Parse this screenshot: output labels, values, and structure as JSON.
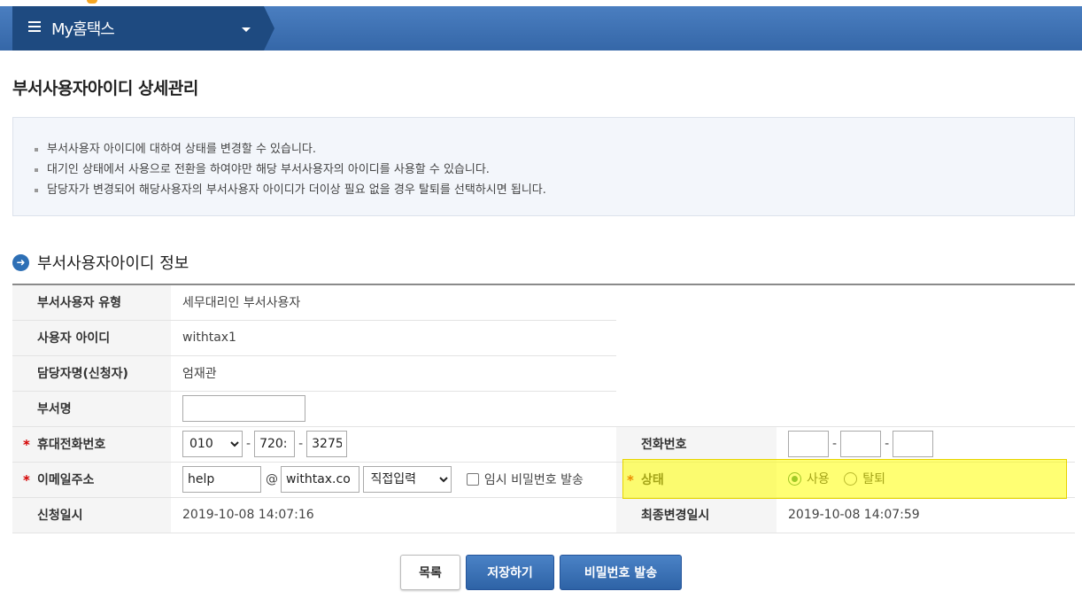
{
  "header": {
    "menu_title": "My홈택스"
  },
  "page": {
    "title": "부서사용자아이디 상세관리"
  },
  "notice": {
    "items": [
      "부서사용자 아이디에 대하여 상태를 변경할 수 있습니다.",
      "대기인 상태에서 사용으로 전환을 하여야만 해당 부서사용자의 아이디를 사용할 수 있습니다.",
      "담당자가 변경되어 해당사용자의 부서사용자 아이디가 더이상 필요 없을 경우 탈퇴를 선택하시면 됩니다."
    ]
  },
  "section": {
    "title": "부서사용자아이디 정보"
  },
  "form": {
    "user_type_label": "부서사용자 유형",
    "user_type_value": "세무대리인 부서사용자",
    "user_id_label": "사용자 아이디",
    "user_id_value": "withtax1",
    "manager_label": "담당자명(신청자)",
    "manager_value": "엄재관",
    "dept_label": "부서명",
    "dept_value": "",
    "mobile_label": "휴대전화번호",
    "mobile_prefix": "010",
    "mobile_mid": "720:",
    "mobile_last": "3275",
    "phone_label": "전화번호",
    "phone_1": "",
    "phone_2": "",
    "phone_3": "",
    "email_label": "이메일주소",
    "email_local": "help",
    "email_at": "@",
    "email_domain": "withtax.co",
    "email_select": "직접입력",
    "temp_pw_label": "임시 비밀번호 발송",
    "status_label": "상태",
    "status_use": "사용",
    "status_withdraw": "탈퇴",
    "status_selected": "사용",
    "applied_label": "신청일시",
    "applied_value": "2019-10-08 14:07:16",
    "modified_label": "최종변경일시",
    "modified_value": "2019-10-08 14:07:59",
    "dash": "-"
  },
  "buttons": {
    "list": "목록",
    "save": "저장하기",
    "send_password": "비밀번호 발송"
  }
}
